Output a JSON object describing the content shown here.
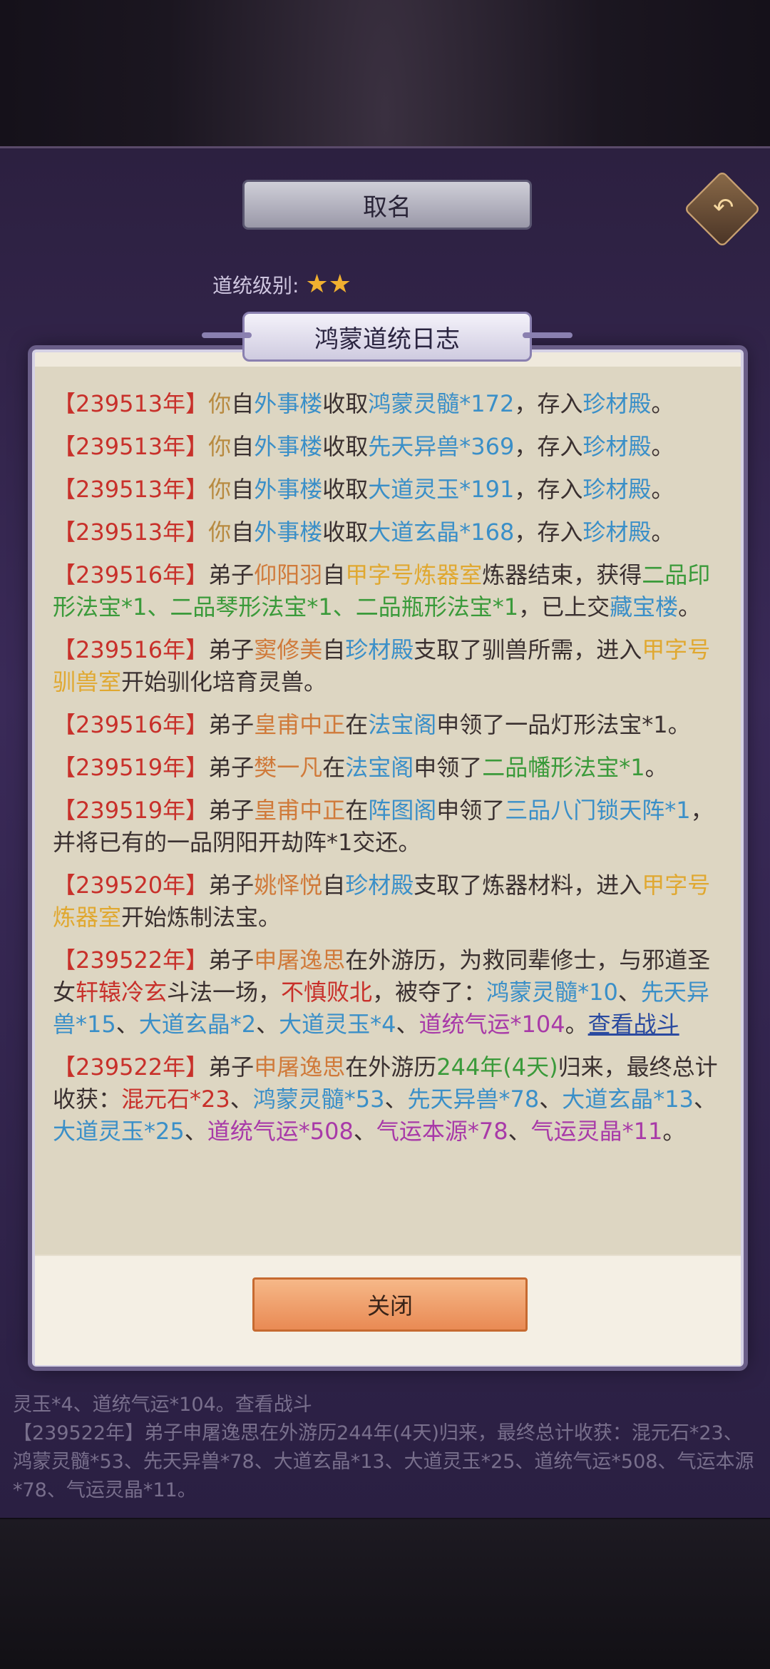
{
  "header": {
    "title": "取名",
    "back_icon": "back-arrow-icon"
  },
  "level": {
    "label": "道统级别:",
    "stars": 2
  },
  "dialog": {
    "title": "鸿蒙道统日志",
    "close_label": "关闭"
  },
  "log_entries": [
    {
      "year": "【239513年】",
      "parts": [
        {
          "t": "你",
          "c": "c-ni"
        },
        {
          "t": "自"
        },
        {
          "t": "外事楼",
          "c": "c-loc"
        },
        {
          "t": "收取"
        },
        {
          "t": "鸿蒙灵髓*172",
          "c": "c-item"
        },
        {
          "t": "，存入"
        },
        {
          "t": "珍材殿",
          "c": "c-loc"
        },
        {
          "t": "。"
        }
      ]
    },
    {
      "year": "【239513年】",
      "parts": [
        {
          "t": "你",
          "c": "c-ni"
        },
        {
          "t": "自"
        },
        {
          "t": "外事楼",
          "c": "c-loc"
        },
        {
          "t": "收取"
        },
        {
          "t": "先天异兽*369",
          "c": "c-item"
        },
        {
          "t": "，存入"
        },
        {
          "t": "珍材殿",
          "c": "c-loc"
        },
        {
          "t": "。"
        }
      ]
    },
    {
      "year": "【239513年】",
      "parts": [
        {
          "t": "你",
          "c": "c-ni"
        },
        {
          "t": "自"
        },
        {
          "t": "外事楼",
          "c": "c-loc"
        },
        {
          "t": "收取"
        },
        {
          "t": "大道灵玉*191",
          "c": "c-item"
        },
        {
          "t": "，存入"
        },
        {
          "t": "珍材殿",
          "c": "c-loc"
        },
        {
          "t": "。"
        }
      ]
    },
    {
      "year": "【239513年】",
      "parts": [
        {
          "t": "你",
          "c": "c-ni"
        },
        {
          "t": "自"
        },
        {
          "t": "外事楼",
          "c": "c-loc"
        },
        {
          "t": "收取"
        },
        {
          "t": "大道玄晶*168",
          "c": "c-item"
        },
        {
          "t": "，存入"
        },
        {
          "t": "珍材殿",
          "c": "c-loc"
        },
        {
          "t": "。"
        }
      ]
    },
    {
      "year": "【239516年】",
      "parts": [
        {
          "t": "弟子"
        },
        {
          "t": "仰阳羽",
          "c": "c-name"
        },
        {
          "t": "自"
        },
        {
          "t": "甲字号炼器室",
          "c": "c-room"
        },
        {
          "t": "炼器结束，获得"
        },
        {
          "t": "二品印形法宝*1、二品琴形法宝*1、二品瓶形法宝*1",
          "c": "c-green"
        },
        {
          "t": "，已上交"
        },
        {
          "t": "藏宝楼",
          "c": "c-loc"
        },
        {
          "t": "。"
        }
      ]
    },
    {
      "year": "【239516年】",
      "parts": [
        {
          "t": "弟子"
        },
        {
          "t": "窦修美",
          "c": "c-name"
        },
        {
          "t": "自"
        },
        {
          "t": "珍材殿",
          "c": "c-loc"
        },
        {
          "t": "支取了驯兽所需，进入"
        },
        {
          "t": "甲字号驯兽室",
          "c": "c-room"
        },
        {
          "t": "开始驯化培育灵兽。"
        }
      ]
    },
    {
      "year": "【239516年】",
      "parts": [
        {
          "t": "弟子"
        },
        {
          "t": "皇甫中正",
          "c": "c-name"
        },
        {
          "t": "在"
        },
        {
          "t": "法宝阁",
          "c": "c-loc"
        },
        {
          "t": "申领了一品灯形法宝*1。"
        }
      ]
    },
    {
      "year": "【239519年】",
      "parts": [
        {
          "t": "弟子"
        },
        {
          "t": "樊一凡",
          "c": "c-name"
        },
        {
          "t": "在"
        },
        {
          "t": "法宝阁",
          "c": "c-loc"
        },
        {
          "t": "申领了"
        },
        {
          "t": "二品幡形法宝*1",
          "c": "c-green"
        },
        {
          "t": "。"
        }
      ]
    },
    {
      "year": "【239519年】",
      "parts": [
        {
          "t": "弟子"
        },
        {
          "t": "皇甫中正",
          "c": "c-name"
        },
        {
          "t": "在"
        },
        {
          "t": "阵图阁",
          "c": "c-loc"
        },
        {
          "t": "申领了"
        },
        {
          "t": "三品八门锁天阵*1",
          "c": "c-item"
        },
        {
          "t": "，并将已有的一品阴阳开劫阵*1交还。"
        }
      ]
    },
    {
      "year": "【239520年】",
      "parts": [
        {
          "t": "弟子"
        },
        {
          "t": "姚怿悦",
          "c": "c-name"
        },
        {
          "t": "自"
        },
        {
          "t": "珍材殿",
          "c": "c-loc"
        },
        {
          "t": "支取了炼器材料，进入"
        },
        {
          "t": "甲字号炼器室",
          "c": "c-room"
        },
        {
          "t": "开始炼制法宝。"
        }
      ]
    },
    {
      "year": "【239522年】",
      "parts": [
        {
          "t": "弟子"
        },
        {
          "t": "申屠逸思",
          "c": "c-name"
        },
        {
          "t": "在外游历，为救同辈修士，与邪道圣女"
        },
        {
          "t": "轩辕冷玄",
          "c": "c-red"
        },
        {
          "t": "斗法一场，"
        },
        {
          "t": "不慎败北",
          "c": "c-red"
        },
        {
          "t": "，被夺了："
        },
        {
          "t": "鸿蒙灵髓*10",
          "c": "c-item"
        },
        {
          "t": "、"
        },
        {
          "t": "先天异兽*15",
          "c": "c-item"
        },
        {
          "t": "、"
        },
        {
          "t": "大道玄晶*2",
          "c": "c-item"
        },
        {
          "t": "、"
        },
        {
          "t": "大道灵玉*4",
          "c": "c-item"
        },
        {
          "t": "、"
        },
        {
          "t": "道统气运*104",
          "c": "c-purple"
        },
        {
          "t": "。"
        },
        {
          "t": "查看战斗",
          "c": "c-link"
        }
      ]
    },
    {
      "year": "【239522年】",
      "parts": [
        {
          "t": "弟子"
        },
        {
          "t": "申屠逸思",
          "c": "c-name"
        },
        {
          "t": "在外游历"
        },
        {
          "t": "244年(4天)",
          "c": "c-green"
        },
        {
          "t": "归来，最终总计收获："
        },
        {
          "t": "混元石*23",
          "c": "c-red"
        },
        {
          "t": "、"
        },
        {
          "t": "鸿蒙灵髓*53",
          "c": "c-item"
        },
        {
          "t": "、"
        },
        {
          "t": "先天异兽*78",
          "c": "c-item"
        },
        {
          "t": "、"
        },
        {
          "t": "大道玄晶*13",
          "c": "c-item"
        },
        {
          "t": "、"
        },
        {
          "t": "大道灵玉*25",
          "c": "c-item"
        },
        {
          "t": "、"
        },
        {
          "t": "道统气运*508",
          "c": "c-purple"
        },
        {
          "t": "、"
        },
        {
          "t": "气运本源*78",
          "c": "c-purple"
        },
        {
          "t": "、"
        },
        {
          "t": "气运灵晶*11",
          "c": "c-purple"
        },
        {
          "t": "。"
        }
      ]
    }
  ],
  "background_log": [
    "灵玉*4、道统气运*104。查看战斗",
    "【239522年】弟子申屠逸思在外游历244年(4天)归来，最终总计收获：混元石*23、鸿蒙灵髓*53、先天异兽*78、大道玄晶*13、大道灵玉*25、道统气运*508、气运本源*78、气运灵晶*11。"
  ]
}
